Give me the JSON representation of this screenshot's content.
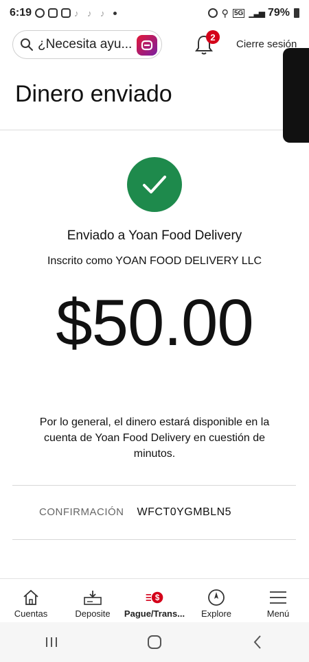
{
  "status_bar": {
    "time": "6:19",
    "battery": "79%",
    "network": "5G"
  },
  "header": {
    "search_placeholder": "¿Necesita ayu...",
    "notification_count": "2",
    "logout_label": "Cierre sesión"
  },
  "page": {
    "title": "Dinero enviado",
    "sent_to": "Enviado a Yoan Food Delivery",
    "registered_as": "Inscrito como YOAN FOOD DELIVERY LLC",
    "amount": "$50.00",
    "info": "Por lo general, el dinero estará disponible en la cuenta de Yoan Food Delivery en cuestión de minutos.",
    "confirmation_label": "CONFIRMACIÓN",
    "confirmation_value": "WFCT0YGMBLN5"
  },
  "bottom_nav": {
    "items": [
      {
        "label": "Cuentas",
        "icon": "house-icon"
      },
      {
        "label": "Deposite",
        "icon": "deposit-icon"
      },
      {
        "label": "Pague/Trans...",
        "icon": "pay-transfer-icon"
      },
      {
        "label": "Explore",
        "icon": "compass-icon"
      },
      {
        "label": "Menú",
        "icon": "menu-icon"
      }
    ]
  },
  "colors": {
    "success_green": "#1e8a4c",
    "badge_red": "#d4001a",
    "brand_red": "#e31837"
  }
}
